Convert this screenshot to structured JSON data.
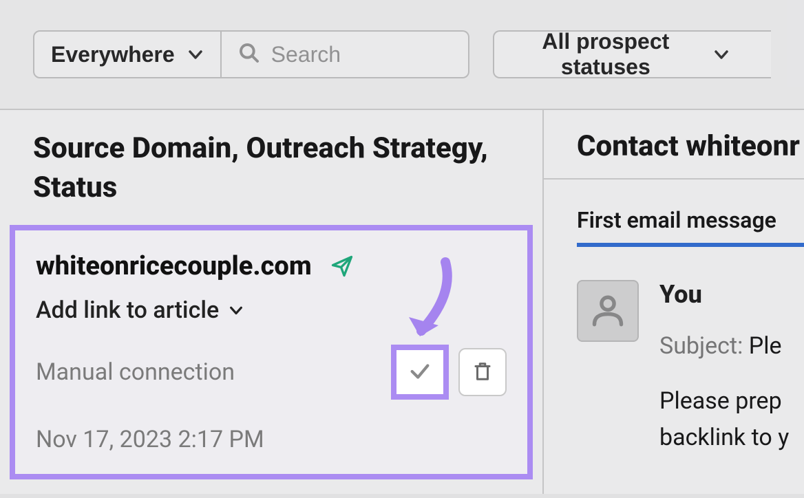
{
  "filters": {
    "scope_label": "Everywhere",
    "search_placeholder": "Search",
    "status_label": "All prospect statuses"
  },
  "left_column": {
    "header": "Source Domain, Outreach Strategy, Status",
    "card": {
      "domain": "whiteonricecouple.com",
      "strategy_label": "Add link to article",
      "connection_label": "Manual connection",
      "timestamp": "Nov 17, 2023 2:17 PM"
    }
  },
  "right_column": {
    "header": "Contact whiteonr",
    "tab_label": "First email message",
    "message": {
      "author": "You",
      "subject_label": "Subject:",
      "subject_value": "Ple",
      "body_line1": "Please prep",
      "body_line2": "backlink to y"
    }
  }
}
